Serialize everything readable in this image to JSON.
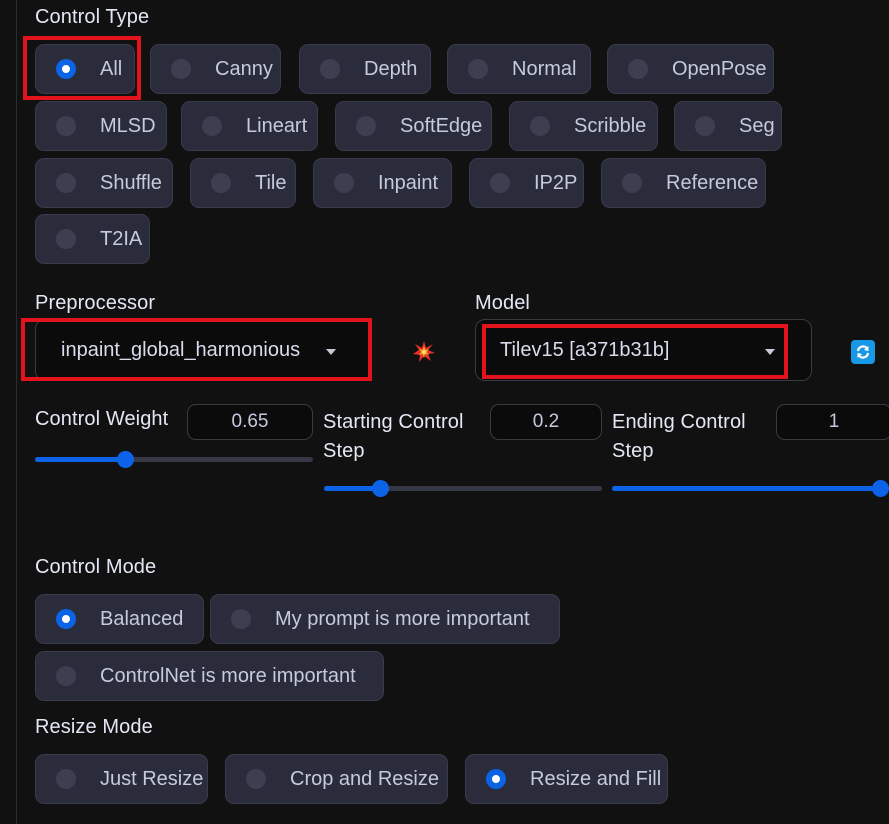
{
  "control_type": {
    "label": "Control Type",
    "selected": "All",
    "options": [
      "All",
      "Canny",
      "Depth",
      "Normal",
      "OpenPose",
      "MLSD",
      "Lineart",
      "SoftEdge",
      "Scribble",
      "Seg",
      "Shuffle",
      "Tile",
      "Inpaint",
      "IP2P",
      "Reference",
      "T2IA"
    ]
  },
  "preprocessor": {
    "label": "Preprocessor",
    "value": "inpaint_global_harmonious"
  },
  "run_preprocessor_icon": "collision-icon",
  "model": {
    "label": "Model",
    "value": "Tilev15 [a371b31b]",
    "refresh_icon": "refresh-icon"
  },
  "control_weight": {
    "label": "Control Weight",
    "value": "0.65",
    "fraction": 0.325
  },
  "starting_step": {
    "label_line1": "Starting Control",
    "label_line2": "Step",
    "value": "0.2",
    "fraction": 0.2
  },
  "ending_step": {
    "label_line1": "Ending Control",
    "label_line2": "Step",
    "value": "1",
    "fraction": 1.0
  },
  "control_mode": {
    "label": "Control Mode",
    "selected": "Balanced",
    "options": [
      "Balanced",
      "My prompt is more important",
      "ControlNet is more important"
    ]
  },
  "resize_mode": {
    "label": "Resize Mode",
    "selected": "Resize and Fill",
    "options": [
      "Just Resize",
      "Crop and Resize",
      "Resize and Fill"
    ]
  },
  "colors": {
    "accent": "#0b63e6",
    "highlight": "#e3131c",
    "button_bg": "#2b2c3b",
    "background": "#111112"
  }
}
